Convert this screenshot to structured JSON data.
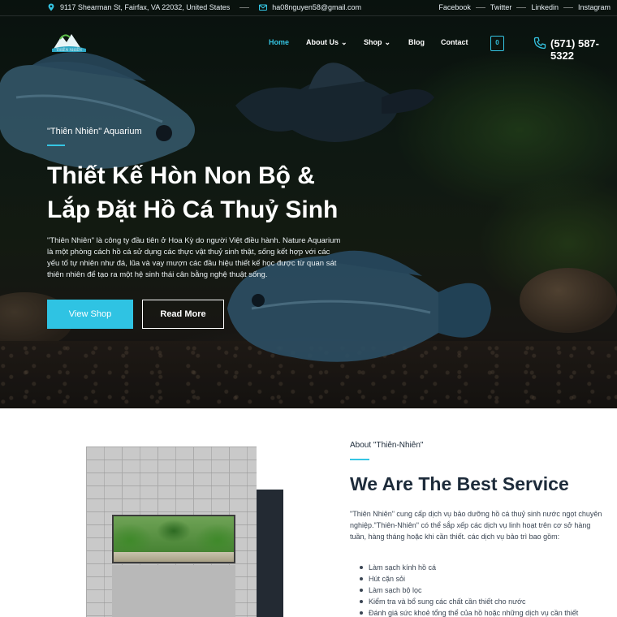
{
  "topbar": {
    "address": "9117 Shearman St, Fairfax, VA 22032, United States",
    "email": "ha08nguyen58@gmail.com",
    "social": [
      "Facebook",
      "Twitter",
      "Linkedin",
      "Instagram"
    ]
  },
  "logo": {
    "text": "THIÊN NHIÊN"
  },
  "nav": {
    "home": "Home",
    "about": "About Us",
    "shop": "Shop",
    "blog": "Blog",
    "contact": "Contact",
    "cart_count": "0",
    "phone": "(571) 587-5322"
  },
  "hero": {
    "subtitle": "\"Thiên Nhiên\" Aquarium",
    "title_line1": "Thiết Kế Hòn Non Bộ &",
    "title_line2": "Lắp Đặt Hồ Cá Thuỷ Sinh",
    "description": "\"Thiên Nhiên\" là công ty đầu tiên ở Hoa Kỳ do người Việt điều hành. Nature Aquarium là một phòng cách hồ cá sử dụng các thực vật thuỷ sinh thật, sống kết hợp với các yếu tố tự nhiên như đá, lũa và vay mượn các đầu hiệu thiết kế học được từ quan sát thiên nhiên để tạo ra một hệ sinh thái cân bằng nghệ thuật sống.",
    "btn_primary": "View Shop",
    "btn_secondary": "Read More"
  },
  "about": {
    "label": "About \"Thiên-Nhiên\"",
    "title": "We Are The Best Service",
    "description": "\"Thiên Nhiên\" cung cấp dịch vụ bảo dưỡng hồ cá thuỷ sinh nước ngọt chuyên nghiệp.\"Thiên-Nhiên\" có thể sắp xếp các dịch vụ linh hoạt trên cơ sở hàng tuần, hàng tháng hoặc khi cần thiết. các dịch vụ bảo trì bao gồm:",
    "services": [
      "Làm sạch kính hồ cá",
      "Hút cặn sỏi",
      "Làm sạch bộ lọc",
      "Kiểm tra và bổ sung các chất cần thiết cho nước",
      "Đánh giá sức khoẻ tổng thể của hồ hoặc những dịch vụ cần thiết"
    ]
  },
  "colors": {
    "accent": "#35c5e3",
    "dark": "#1d2b3a"
  },
  "icons": [
    "map-pin-icon",
    "mail-icon",
    "chevron-down-icon",
    "cart-icon",
    "phone-icon"
  ]
}
